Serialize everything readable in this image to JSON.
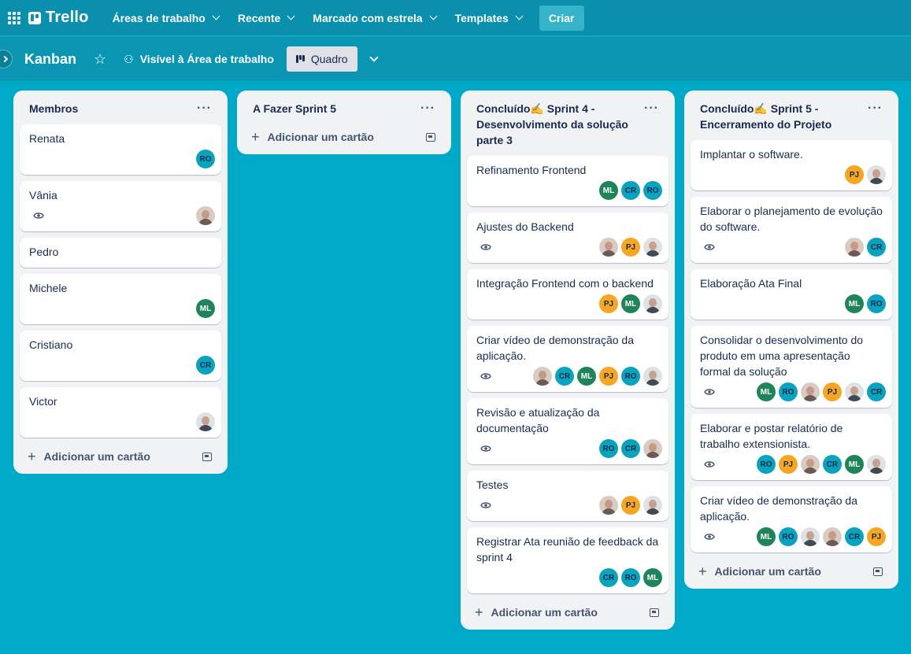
{
  "nav": {
    "logo": "Trello",
    "items": [
      "Áreas de trabalho",
      "Recente",
      "Marcado com estrela",
      "Templates"
    ],
    "create": "Criar"
  },
  "board": {
    "title": "Kanban",
    "visibility": "Visível à Área de trabalho",
    "view": "Quadro"
  },
  "add_card_label": "Adicionar um cartão",
  "lists": [
    {
      "title": "Membros",
      "cards": [
        {
          "title": "Renata",
          "watch": false,
          "members": [
            {
              "initials": "RO",
              "color": "teal"
            }
          ]
        },
        {
          "title": "Vânia",
          "watch": true,
          "members": [
            {
              "initials": "",
              "color": "photo"
            }
          ]
        },
        {
          "title": "Pedro",
          "watch": false,
          "members": []
        },
        {
          "title": "Michele",
          "watch": false,
          "members": [
            {
              "initials": "ML",
              "color": "green"
            }
          ]
        },
        {
          "title": "Cristiano",
          "watch": false,
          "members": [
            {
              "initials": "CR",
              "color": "teal"
            }
          ]
        },
        {
          "title": "Victor",
          "watch": false,
          "members": [
            {
              "initials": "",
              "color": "photo m"
            }
          ]
        }
      ]
    },
    {
      "title": "A Fazer Sprint 5",
      "cards": []
    },
    {
      "title": "Concluído✍️ Sprint 4 - Desenvolvimento da solução parte 3",
      "cards": [
        {
          "title": "Refinamento Frontend",
          "watch": false,
          "members": [
            {
              "initials": "ML",
              "color": "green"
            },
            {
              "initials": "CR",
              "color": "teal"
            },
            {
              "initials": "RO",
              "color": "teal"
            }
          ]
        },
        {
          "title": "Ajustes do Backend",
          "watch": true,
          "members": [
            {
              "initials": "",
              "color": "photo"
            },
            {
              "initials": "PJ",
              "color": "orange"
            },
            {
              "initials": "",
              "color": "photo m"
            }
          ]
        },
        {
          "title": "Integração Frontend com o backend",
          "watch": false,
          "members": [
            {
              "initials": "PJ",
              "color": "orange"
            },
            {
              "initials": "ML",
              "color": "green"
            },
            {
              "initials": "",
              "color": "photo m"
            }
          ]
        },
        {
          "title": "Criar vídeo de demonstração da aplicação.",
          "watch": true,
          "members": [
            {
              "initials": "",
              "color": "photo"
            },
            {
              "initials": "CR",
              "color": "teal"
            },
            {
              "initials": "ML",
              "color": "green"
            },
            {
              "initials": "PJ",
              "color": "orange"
            },
            {
              "initials": "RO",
              "color": "teal"
            },
            {
              "initials": "",
              "color": "photo m"
            }
          ]
        },
        {
          "title": "Revisão e atualização da documentação",
          "watch": true,
          "members": [
            {
              "initials": "RO",
              "color": "teal"
            },
            {
              "initials": "CR",
              "color": "teal"
            },
            {
              "initials": "",
              "color": "photo"
            }
          ]
        },
        {
          "title": "Testes",
          "watch": true,
          "members": [
            {
              "initials": "",
              "color": "photo"
            },
            {
              "initials": "PJ",
              "color": "orange"
            },
            {
              "initials": "",
              "color": "photo m"
            }
          ]
        },
        {
          "title": "Registrar Ata reunião de feedback da sprint 4",
          "watch": false,
          "members": [
            {
              "initials": "CR",
              "color": "teal"
            },
            {
              "initials": "RO",
              "color": "teal"
            },
            {
              "initials": "ML",
              "color": "green"
            }
          ]
        }
      ]
    },
    {
      "title": "Concluído✍️ Sprint 5 - Encerramento do Projeto",
      "cards": [
        {
          "title": "Implantar o software.",
          "watch": false,
          "members": [
            {
              "initials": "PJ",
              "color": "orange"
            },
            {
              "initials": "",
              "color": "photo m"
            }
          ]
        },
        {
          "title": "Elaborar o planejamento de evolução do software.",
          "watch": true,
          "members": [
            {
              "initials": "",
              "color": "photo"
            },
            {
              "initials": "CR",
              "color": "teal"
            }
          ]
        },
        {
          "title": "Elaboração Ata Final",
          "watch": false,
          "members": [
            {
              "initials": "ML",
              "color": "green"
            },
            {
              "initials": "RO",
              "color": "teal"
            }
          ]
        },
        {
          "title": "Consolidar o desenvolvimento do produto em uma apresentação formal da solução",
          "watch": true,
          "members": [
            {
              "initials": "ML",
              "color": "green"
            },
            {
              "initials": "RO",
              "color": "teal"
            },
            {
              "initials": "",
              "color": "photo"
            },
            {
              "initials": "PJ",
              "color": "orange"
            },
            {
              "initials": "",
              "color": "photo m"
            },
            {
              "initials": "CR",
              "color": "teal"
            }
          ]
        },
        {
          "title": "Elaborar e postar relatório de trabalho extensionista.",
          "watch": true,
          "members": [
            {
              "initials": "RO",
              "color": "teal"
            },
            {
              "initials": "PJ",
              "color": "orange"
            },
            {
              "initials": "",
              "color": "photo"
            },
            {
              "initials": "CR",
              "color": "teal"
            },
            {
              "initials": "ML",
              "color": "green"
            },
            {
              "initials": "",
              "color": "photo m"
            }
          ]
        },
        {
          "title": "Criar vídeo de demonstração da aplicação.",
          "watch": true,
          "members": [
            {
              "initials": "ML",
              "color": "green"
            },
            {
              "initials": "RO",
              "color": "teal"
            },
            {
              "initials": "",
              "color": "photo m"
            },
            {
              "initials": "",
              "color": "photo"
            },
            {
              "initials": "CR",
              "color": "teal"
            },
            {
              "initials": "PJ",
              "color": "orange"
            }
          ]
        }
      ]
    }
  ]
}
